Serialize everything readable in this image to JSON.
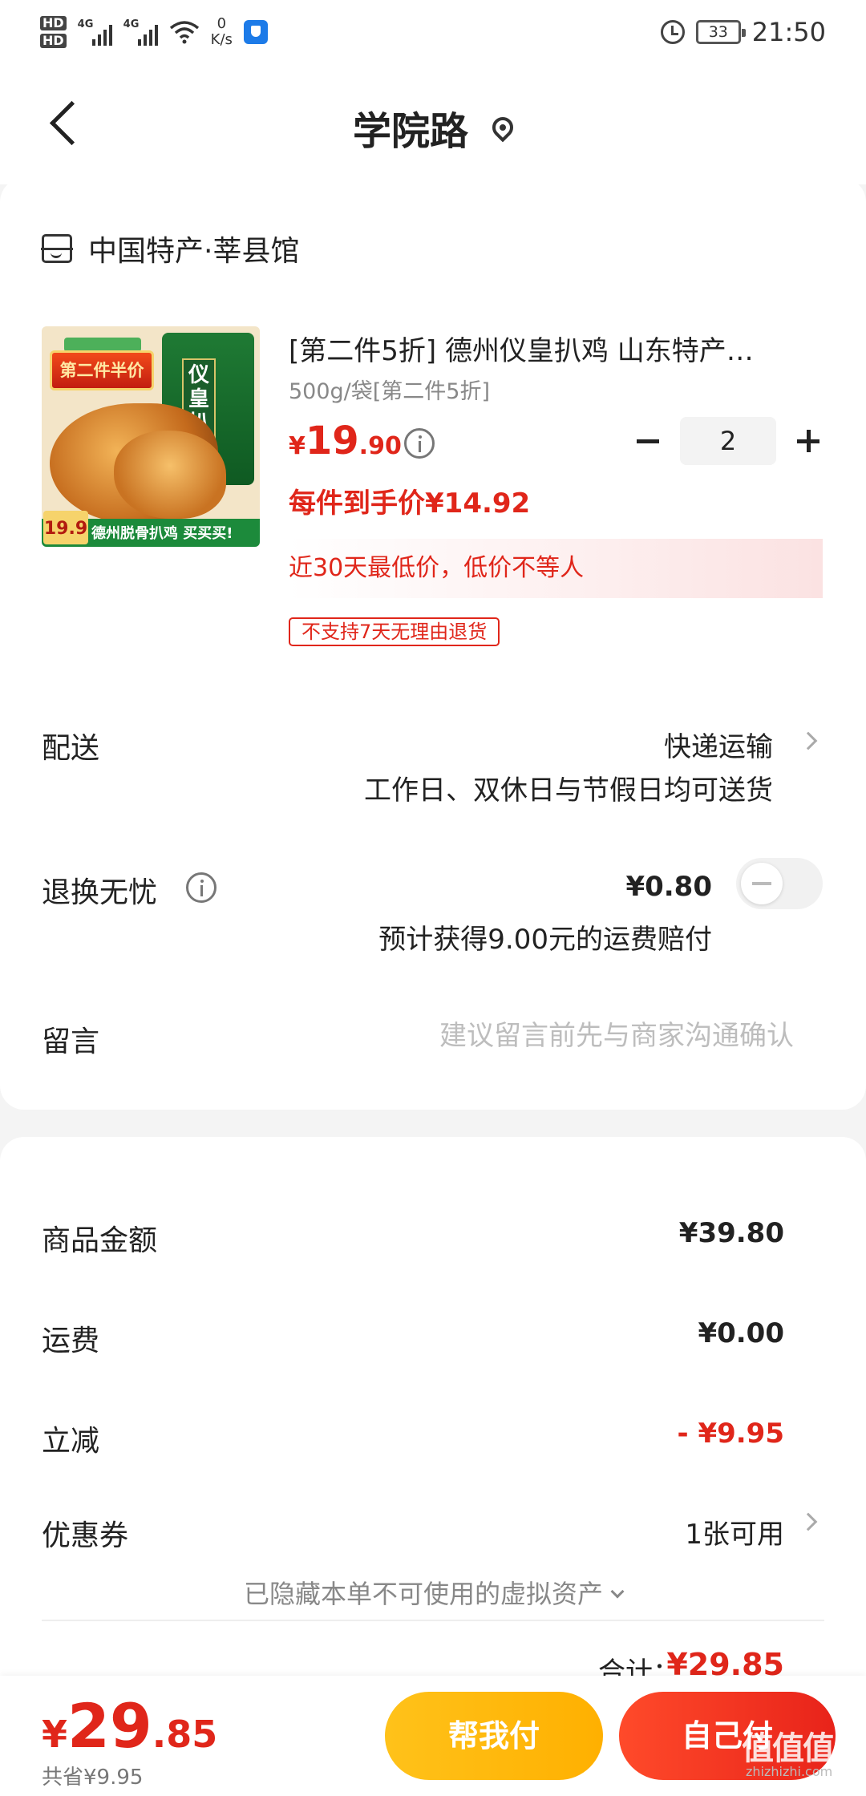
{
  "status_bar": {
    "hd1": "HD",
    "hd2": "HD",
    "sig1": "4G",
    "sig2": "4G",
    "net_speed_value": "0",
    "net_speed_unit": "K/s",
    "battery": "33",
    "time": "21:50"
  },
  "header": {
    "title": "学院路"
  },
  "shop": {
    "name": "中国特产·莘县馆"
  },
  "product": {
    "image_promo_top": "第二件半价",
    "image_promo_price": "19.9",
    "image_promo_text": "德州脱骨扒鸡 买买买!",
    "image_bag_label": "仪皇扒鸡",
    "title": "[第二件5折] 德州仪皇扒鸡 山东特产…",
    "sku": "500g/袋[第二件5折]",
    "price_yen": "¥",
    "price_int": "19",
    "price_dec": ".90",
    "quantity": "2",
    "final_price": "每件到手价¥14.92",
    "lowest_banner": "近30天最低价，低价不等人",
    "no_return_tag": "不支持7天无理由退货"
  },
  "delivery": {
    "label": "配送",
    "method": "快递运输",
    "note": "工作日、双休日与节假日均可送货"
  },
  "worry_free": {
    "label": "退换无忧",
    "price": "¥0.80",
    "note": "预计获得9.00元的运费赔付",
    "enabled": false
  },
  "message": {
    "label": "留言",
    "placeholder": "建议留言前先与商家沟通确认",
    "value": ""
  },
  "summary": {
    "goods_label": "商品金额",
    "goods_value": "¥39.80",
    "shipping_label": "运费",
    "shipping_value": "¥0.00",
    "discount_label": "立减",
    "discount_value": "- ¥9.95",
    "coupon_label": "优惠券",
    "coupon_value": "1张可用",
    "hidden_assets": "已隐藏本单不可使用的虚拟资产",
    "total_label": "合计：",
    "total_value": "¥29.85"
  },
  "bottom_bar": {
    "price_yen": "¥",
    "price_int": "29",
    "price_dec": ".85",
    "saved": "共省¥9.95",
    "help_pay_label": "帮我付",
    "self_pay_label": "自己付"
  },
  "watermark": {
    "text": "值值值",
    "sub": "zhizhizhi.com"
  },
  "colors": {
    "accent_red": "#e0261a",
    "help_pay_yellow": "#ffb000",
    "self_pay_red": "#e8231a"
  }
}
